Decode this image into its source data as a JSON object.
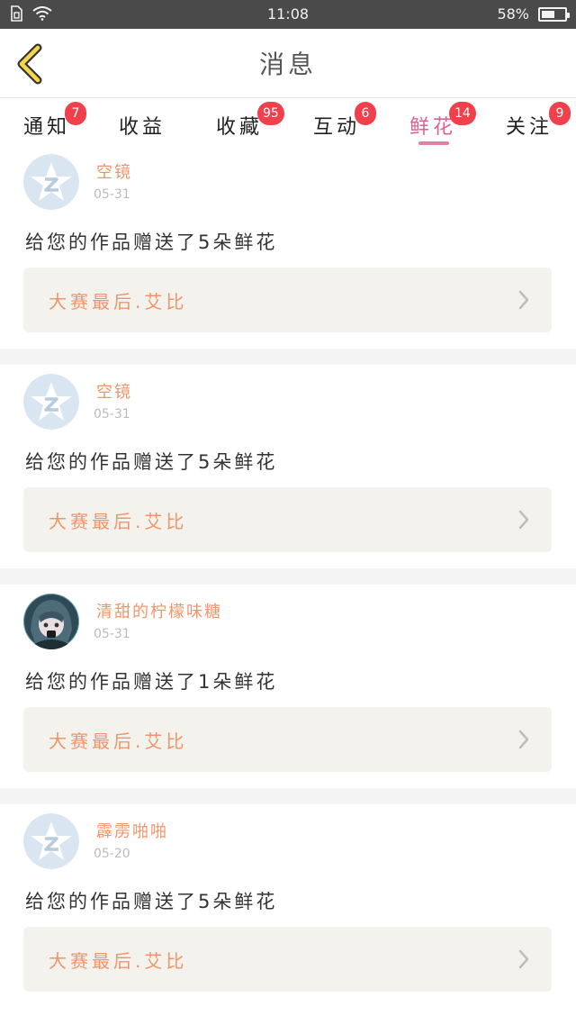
{
  "status": {
    "time": "11:08",
    "battery": "58%",
    "battery_level": 0.58,
    "left_icons": [
      "sim-icon",
      "wifi-icon"
    ]
  },
  "header": {
    "title": "消息",
    "back_icon": "chevron-left-icon"
  },
  "tabs": [
    {
      "label": "通知",
      "badge": "7",
      "active": false
    },
    {
      "label": "收益",
      "badge": "",
      "active": false
    },
    {
      "label": "收藏",
      "badge": "95",
      "active": false
    },
    {
      "label": "互动",
      "badge": "6",
      "active": false
    },
    {
      "label": "鲜花",
      "badge": "14",
      "active": true
    },
    {
      "label": "关注",
      "badge": "9",
      "active": false
    }
  ],
  "feed": [
    {
      "sender": "空镜",
      "date": "05-31",
      "message": "给您的作品赠送了5朵鲜花",
      "work": "大赛最后.艾比",
      "avatar": "default-star-avatar"
    },
    {
      "sender": "空镜",
      "date": "05-31",
      "message": "给您的作品赠送了5朵鲜花",
      "work": "大赛最后.艾比",
      "avatar": "default-star-avatar"
    },
    {
      "sender": "清甜的柠檬味糖",
      "date": "05-31",
      "message": "给您的作品赠送了1朵鲜花",
      "work": "大赛最后.艾比",
      "avatar": "anime-avatar"
    },
    {
      "sender": "霹雳啪啪",
      "date": "05-20",
      "message": "给您的作品赠送了5朵鲜花",
      "work": "大赛最后.艾比",
      "avatar": "default-star-avatar"
    }
  ],
  "colors": {
    "accent": "#e05f91",
    "badge": "#f0404c",
    "sender": "#f0956a",
    "work_bg": "#f3f2ec"
  }
}
